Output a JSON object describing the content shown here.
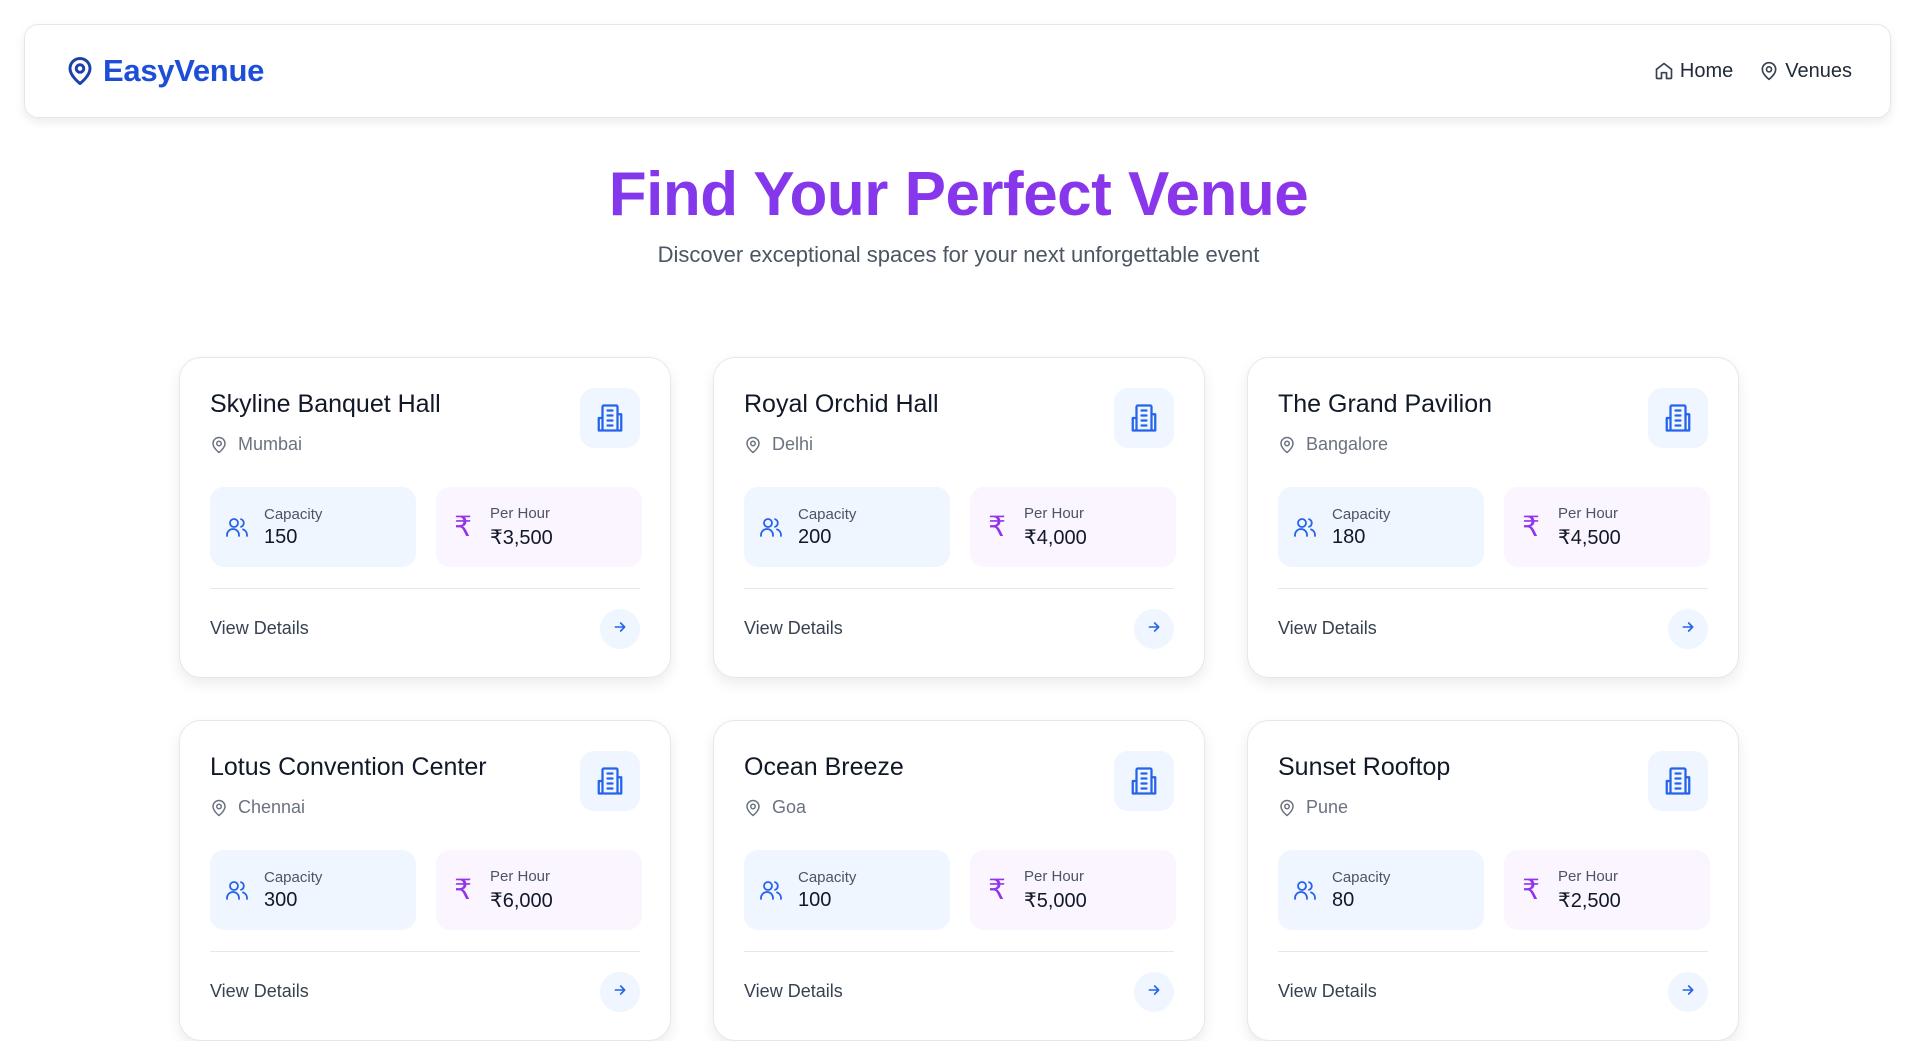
{
  "brand": {
    "name": "EasyVenue",
    "icon": "map-pin-icon"
  },
  "nav": [
    {
      "label": "Home",
      "icon": "home-icon"
    },
    {
      "label": "Venues",
      "icon": "map-pin-icon"
    }
  ],
  "hero": {
    "title": "Find Your Perfect Venue",
    "subtitle": "Discover exceptional spaces for your next unforgettable event"
  },
  "colors": {
    "brand": "#1d4ed8",
    "accent_purple": "#9333ea",
    "capacity_bg": "#eff6ff",
    "price_bg": "#faf5ff"
  },
  "venues": [
    {
      "name": "Skyline Banquet Hall",
      "location": "Mumbai",
      "capacity_label": "Capacity",
      "capacity": "150",
      "price_label": "Per Hour",
      "price": "₹3,500",
      "details_label": "View Details"
    },
    {
      "name": "Royal Orchid Hall",
      "location": "Delhi",
      "capacity_label": "Capacity",
      "capacity": "200",
      "price_label": "Per Hour",
      "price": "₹4,000",
      "details_label": "View Details"
    },
    {
      "name": "The Grand Pavilion",
      "location": "Bangalore",
      "capacity_label": "Capacity",
      "capacity": "180",
      "price_label": "Per Hour",
      "price": "₹4,500",
      "details_label": "View Details"
    },
    {
      "name": "Lotus Convention Center",
      "location": "Chennai",
      "capacity_label": "Capacity",
      "capacity": "300",
      "price_label": "Per Hour",
      "price": "₹6,000",
      "details_label": "View Details"
    },
    {
      "name": "Ocean Breeze",
      "location": "Goa",
      "capacity_label": "Capacity",
      "capacity": "100",
      "price_label": "Per Hour",
      "price": "₹5,000",
      "details_label": "View Details"
    },
    {
      "name": "Sunset Rooftop",
      "location": "Pune",
      "capacity_label": "Capacity",
      "capacity": "80",
      "price_label": "Per Hour",
      "price": "₹2,500",
      "details_label": "View Details"
    }
  ]
}
